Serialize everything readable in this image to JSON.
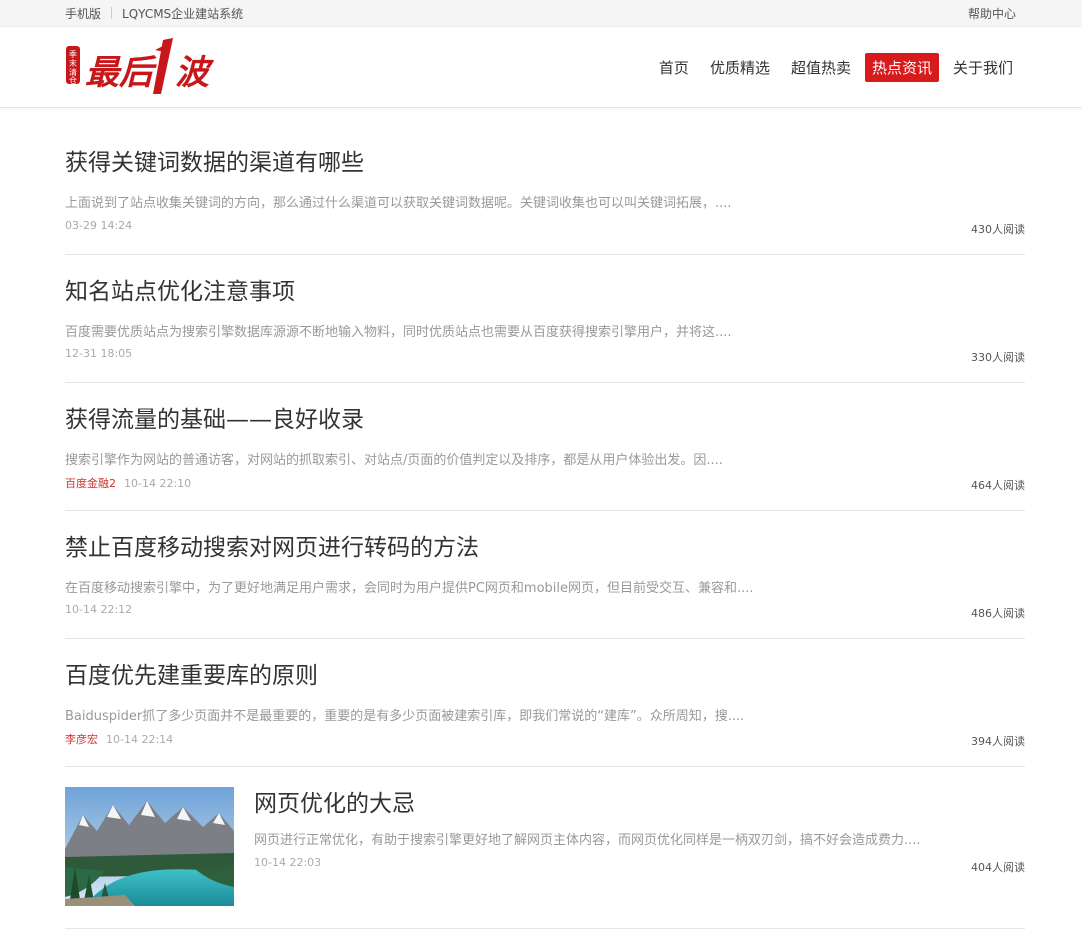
{
  "topbar": {
    "mobile": "手机版",
    "system": "LQYCMS企业建站系统",
    "help": "帮助中心"
  },
  "logo": {
    "seal_text": "季末清仓",
    "main_text": "最后1波"
  },
  "nav": [
    {
      "label": "首页",
      "active": false
    },
    {
      "label": "优质精选",
      "active": false
    },
    {
      "label": "超值热卖",
      "active": false
    },
    {
      "label": "热点资讯",
      "active": true
    },
    {
      "label": "关于我们",
      "active": false
    }
  ],
  "articles": [
    {
      "title": "获得关键词数据的渠道有哪些",
      "summary": "上面说到了站点收集关键词的方向，那么通过什么渠道可以获取关键词数据呢。关键词收集也可以叫关键词拓展，....",
      "author": "",
      "time": "03-29 14:24",
      "reads": "430人阅读"
    },
    {
      "title": "知名站点优化注意事项",
      "summary": "百度需要优质站点为搜索引擎数据库源源不断地输入物料，同时优质站点也需要从百度获得搜索引擎用户，并将这....",
      "author": "",
      "time": "12-31 18:05",
      "reads": "330人阅读"
    },
    {
      "title": "获得流量的基础——良好收录",
      "summary": "搜索引擎作为网站的普通访客，对网站的抓取索引、对站点/页面的价值判定以及排序，都是从用户体验出发。因....",
      "author": "百度金融2",
      "time": "10-14 22:10",
      "reads": "464人阅读"
    },
    {
      "title": "禁止百度移动搜索对网页进行转码的方法",
      "summary": "在百度移动搜索引擎中，为了更好地满足用户需求，会同时为用户提供PC网页和mobile网页，但目前受交互、兼容和....",
      "author": "",
      "time": "10-14 22:12",
      "reads": "486人阅读"
    },
    {
      "title": "百度优先建重要库的原则",
      "summary": "Baiduspider抓了多少页面并不是最重要的，重要的是有多少页面被建索引库，即我们常说的“建库”。众所周知，搜....",
      "author": "李彦宏",
      "time": "10-14 22:14",
      "reads": "394人阅读"
    },
    {
      "title": "网页优化的大忌",
      "summary": "网页进行正常优化，有助于搜索引擎更好地了解网页主体内容，而网页优化同样是一柄双刃剑，搞不好会造成费力....",
      "author": "",
      "time": "10-14 22:03",
      "reads": "404人阅读"
    }
  ],
  "colors": {
    "accent": "#d71a1b",
    "author": "#d2322d",
    "summary": "#999999"
  }
}
